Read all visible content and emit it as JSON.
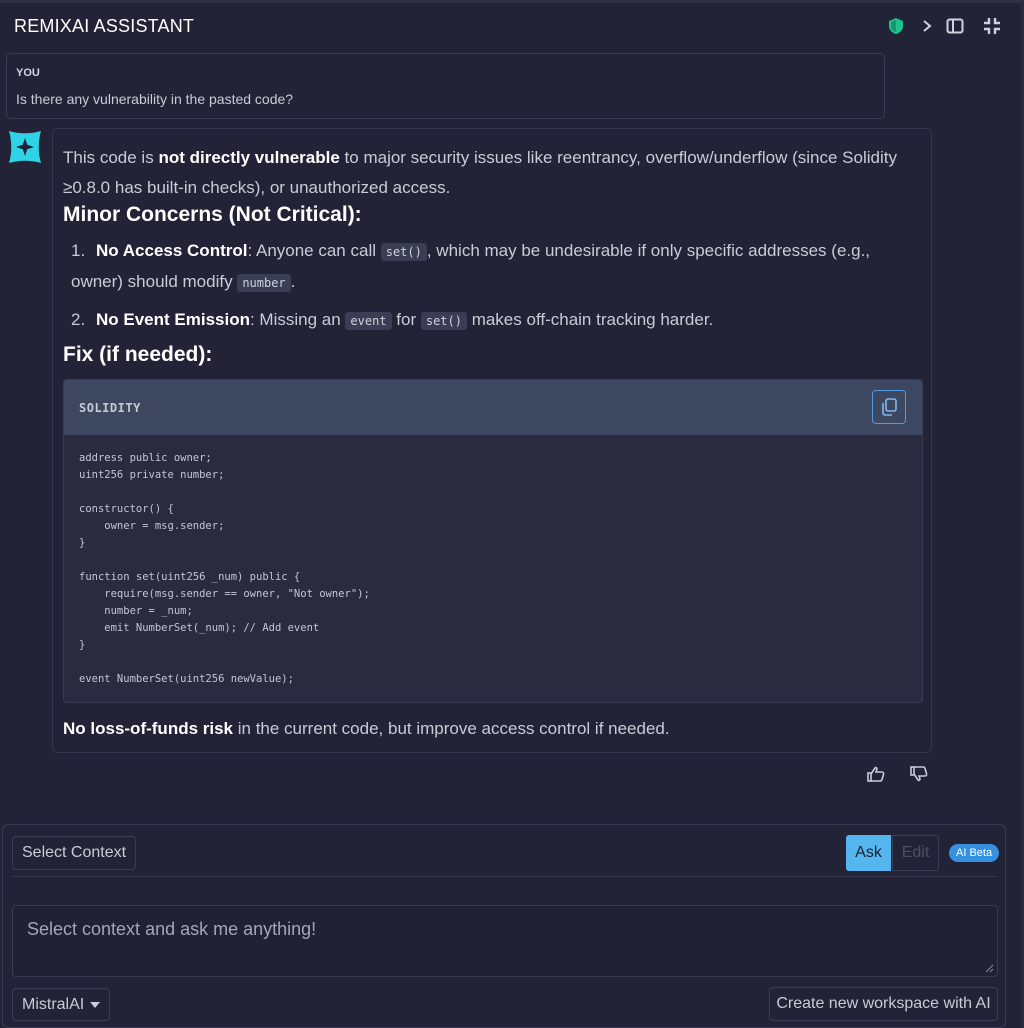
{
  "header": {
    "title": "REMIXAI ASSISTANT"
  },
  "user_message": {
    "label": "YOU",
    "text": "Is there any vulnerability in the pasted code?"
  },
  "response": {
    "intro_prefix": "This code is ",
    "intro_bold": "not directly vulnerable",
    "intro_suffix": " to major security issues like reentrancy, overflow/underflow (since Solidity ≥0.8.0 has built-in checks), or unauthorized access.",
    "heading_concerns": "Minor Concerns (Not Critical):",
    "concerns": [
      {
        "number": "1.",
        "title": "No Access Control",
        "text_a": ": Anyone can call ",
        "code_a": "set()",
        "text_b": ", which may be undesirable if only specific addresses (e.g., owner) should modify ",
        "code_b": "number",
        "text_c": "."
      },
      {
        "number": "2.",
        "title": "No Event Emission",
        "text_a": ": Missing an ",
        "code_a": "event",
        "text_b": " for ",
        "code_b": "set()",
        "text_c": " makes off-chain tracking harder."
      }
    ],
    "heading_fix": "Fix (if needed):",
    "code_lang": "SOLIDITY",
    "code": "address public owner;\nuint256 private number;\n\nconstructor() {\n    owner = msg.sender;\n}\n\nfunction set(uint256 _num) public {\n    require(msg.sender == owner, \"Not owner\");\n    number = _num;\n    emit NumberSet(_num); // Add event\n}\n\nevent NumberSet(uint256 newValue);",
    "closing_bold": "No loss-of-funds risk",
    "closing_text": " in the current code, but improve access control if needed."
  },
  "composer": {
    "context_button": "Select Context",
    "ask_label": "Ask",
    "edit_label": "Edit",
    "beta_badge": "AI Beta",
    "placeholder": "Select context and ask me anything!",
    "model": "MistralAI",
    "workspace_button": "Create new workspace with AI"
  },
  "colors": {
    "background": "#222336",
    "accent_blue": "#55b5ee",
    "badge_blue": "#3590df",
    "shield_green": "#1fc28a",
    "logo_cyan": "#2fd3e6"
  },
  "icons": [
    "shield-icon",
    "chevron-right-icon",
    "panel-icon",
    "minimize-icon",
    "copy-icon",
    "thumbs-up-icon",
    "thumbs-down-icon",
    "caret-down-icon"
  ]
}
